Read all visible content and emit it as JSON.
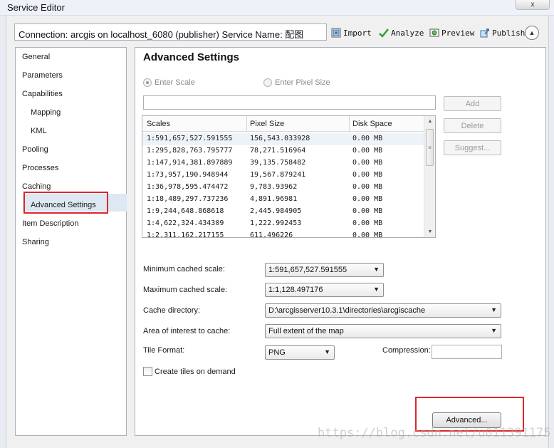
{
  "window": {
    "title": "Service Editor",
    "close_label": "x"
  },
  "toolbar": {
    "connection_text": "Connection: arcgis on localhost_6080 (publisher)   Service Name: 配图",
    "import_label": "Import",
    "analyze_label": "Analyze",
    "preview_label": "Preview",
    "publish_label": "Publish"
  },
  "sidebar": {
    "items": [
      {
        "label": "General"
      },
      {
        "label": "Parameters"
      },
      {
        "label": "Capabilities"
      },
      {
        "label": "Mapping"
      },
      {
        "label": "KML"
      },
      {
        "label": "Pooling"
      },
      {
        "label": "Processes"
      },
      {
        "label": "Caching"
      },
      {
        "label": "Advanced Settings"
      },
      {
        "label": "Item Description"
      },
      {
        "label": "Sharing"
      }
    ],
    "selected": "Advanced Settings"
  },
  "main": {
    "heading": "Advanced Settings",
    "radio_enter_scale": "Enter Scale",
    "radio_enter_pixel_size": "Enter Pixel Size",
    "selected_radio": "Enter Scale",
    "scale_input_value": "",
    "add_label": "Add",
    "delete_label": "Delete",
    "suggest_label": "Suggest...",
    "table": {
      "columns": [
        "Scales",
        "Pixel Size",
        "Disk Space"
      ],
      "rows": [
        [
          "1:591,657,527.591555",
          "156,543.033928",
          "0.00 MB"
        ],
        [
          "1:295,828,763.795777",
          "78,271.516964",
          "0.00 MB"
        ],
        [
          "1:147,914,381.897889",
          "39,135.758482",
          "0.00 MB"
        ],
        [
          "1:73,957,190.948944",
          "19,567.879241",
          "0.00 MB"
        ],
        [
          "1:36,978,595.474472",
          "9,783.93962",
          "0.00 MB"
        ],
        [
          "1:18,489,297.737236",
          "4,891.96981",
          "0.00 MB"
        ],
        [
          "1:9,244,648.868618",
          "2,445.984905",
          "0.00 MB"
        ],
        [
          "1:4,622,324.434309",
          "1,222.992453",
          "0.00 MB"
        ],
        [
          "1:2,311,162.217155",
          "611.496226",
          "0.00 MB"
        ]
      ]
    },
    "min_cached_scale_label": "Minimum cached scale:",
    "min_cached_scale_value": "1:591,657,527.591555",
    "max_cached_scale_label": "Maximum cached scale:",
    "max_cached_scale_value": "1:1,128.497176",
    "cache_directory_label": "Cache directory:",
    "cache_directory_value": "D:\\arcgisserver10.3.1\\directories\\arcgiscache",
    "area_label": "Area of interest to cache:",
    "area_value": "Full extent of the map",
    "tile_format_label": "Tile Format:",
    "tile_format_value": "PNG",
    "compression_label": "Compression:",
    "compression_value": "",
    "create_tiles_label": "Create tiles on demand",
    "create_tiles_checked": false,
    "advanced_label": "Advanced...",
    "watermark": "https://blog.csdn.net/u011391175"
  },
  "colors": {
    "highlight_red": "#e0262a",
    "selection_blue": "#dde8f3"
  }
}
